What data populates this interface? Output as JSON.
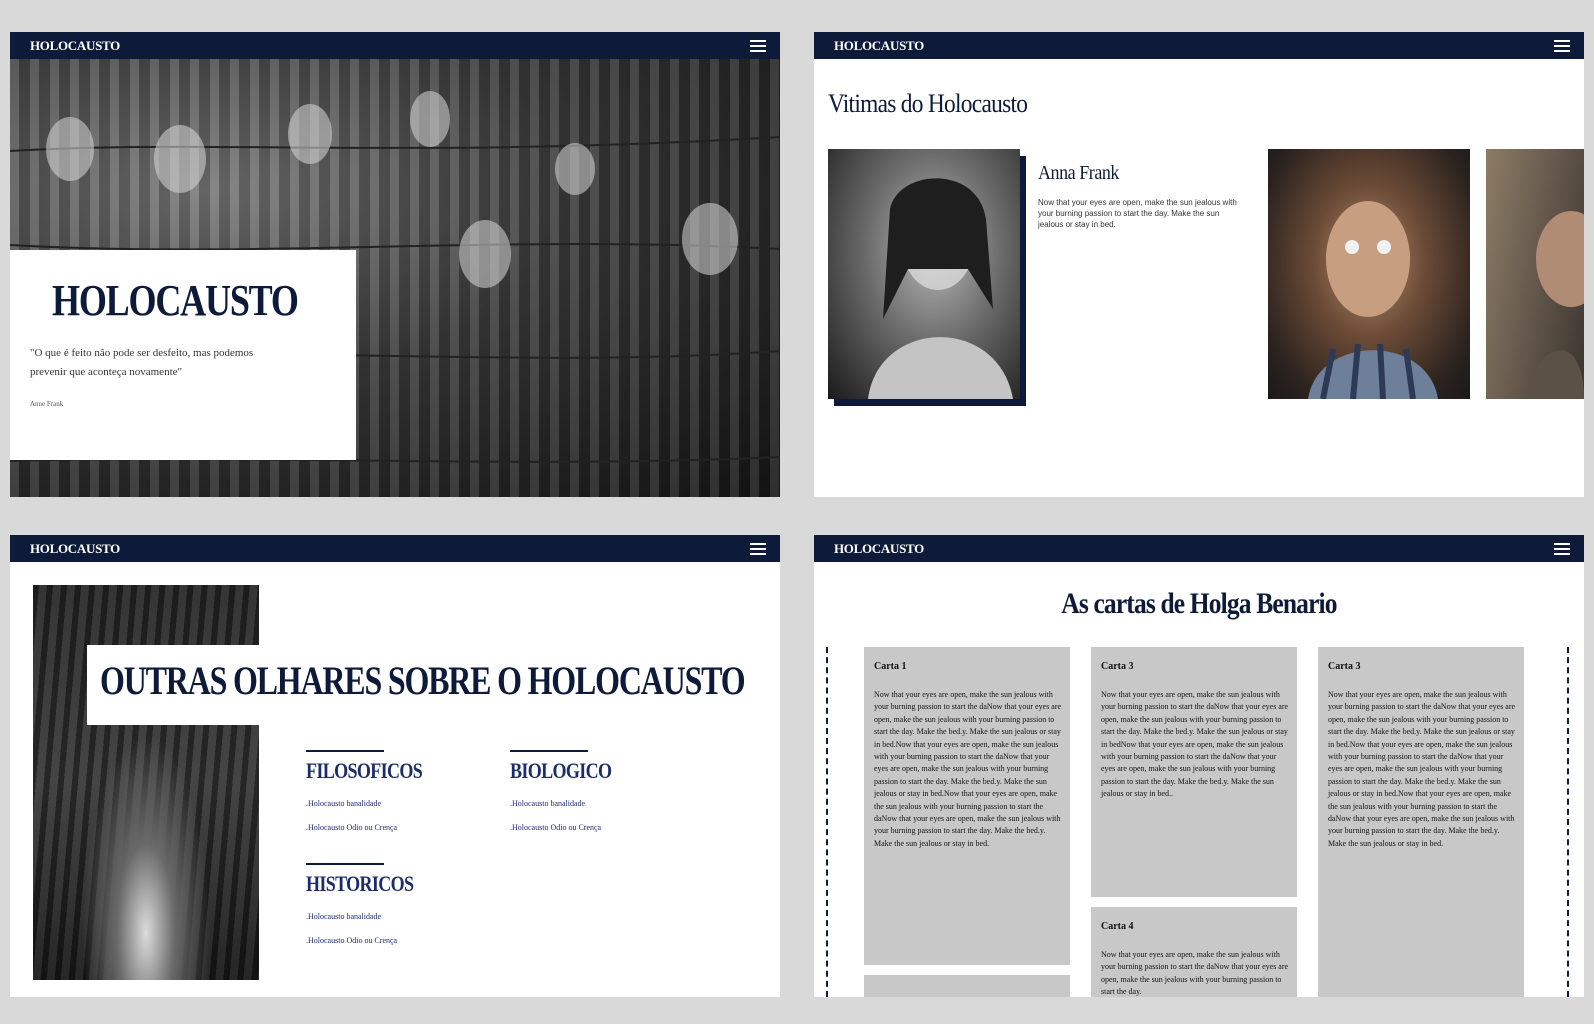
{
  "brand": "HOLOCAUSTO",
  "hero": {
    "title": "HOLOCAUSTO",
    "quote": "\"O que é feito não pode ser desfeito, mas podemos prevenir que aconteça novamente\"",
    "author": "Anne Frank"
  },
  "victims": {
    "title": "Vitimas do Holocausto",
    "featured_name": "Anna Frank",
    "featured_desc": "Now that your eyes are open, make the sun jealous with your burning passion to start the day. Make the sun jealous or stay in bed."
  },
  "views": {
    "title": "OUTRAS OLHARES SOBRE O HOLOCAUSTO",
    "categories": [
      {
        "title": "FILOSOFICOS",
        "links": [
          ".Holocausto banalidade",
          ".Holocausto Odio ou Crença"
        ]
      },
      {
        "title": "BIOLOGICO",
        "links": [
          ".Holocausto banalidade",
          ".Holocausto Odio ou Crença"
        ]
      },
      {
        "title": "HISTORICOS",
        "links": [
          ".Holocausto banalidade",
          ".Holocausto Odio ou Crença"
        ]
      }
    ]
  },
  "letters": {
    "title": "As cartas de Holga Benario",
    "cards": [
      {
        "title": "Carta 1",
        "body": "Now that your eyes are open, make the sun jealous with your burning passion to start the daNow that your eyes are open, make the sun jealous with your burning passion to start the day. Make the bed.y. Make the sun jealous or stay in bed.Now that your eyes are open, make the sun jealous with your burning passion to start the daNow that your eyes are open, make the sun jealous with your burning passion to start the day. Make the bed.y. Make the sun jealous or stay in bed.Now that your eyes are open, make the sun jealous with your burning passion to start the daNow that your eyes are open, make the sun jealous with your burning passion to start the day. Make the bed.y. Make the sun jealous or stay in bed."
      },
      {
        "title": "Carta 3",
        "body": "Now that your eyes are open, make the sun jealous with your burning passion to start the daNow that your eyes are open, make the sun jealous with your burning passion to start the day. Make the bed.y. Make the sun jealous or stay in bedNow that your eyes are open, make the sun jealous with your burning passion to start the daNow that your eyes are open, make the sun jealous with your burning passion to start the day. Make the bed.y. Make the sun jealous or stay in bed.."
      },
      {
        "title": "Carta 3",
        "body": "Now that your eyes are open, make the sun jealous with your burning passion to start the daNow that your eyes are open, make the sun jealous with your burning passion to start the day. Make the bed.y. Make the sun jealous or stay in bed.Now that your eyes are open, make the sun jealous with your burning passion to start the daNow that your eyes are open, make the sun jealous with your burning passion to start the day. Make the bed.y. Make the sun jealous or stay in bed.Now that your eyes are open, make the sun jealous with your burning passion to start the daNow that your eyes are open, make the sun jealous with your burning passion to start the day. Make the bed.y. Make the sun jealous or stay in bed."
      },
      {
        "title": "Carta 4",
        "body": "Now that your eyes are open, make the sun jealous with your burning passion to start the daNow that your eyes are open, make the sun jealous with your burning passion to start the day."
      }
    ]
  }
}
